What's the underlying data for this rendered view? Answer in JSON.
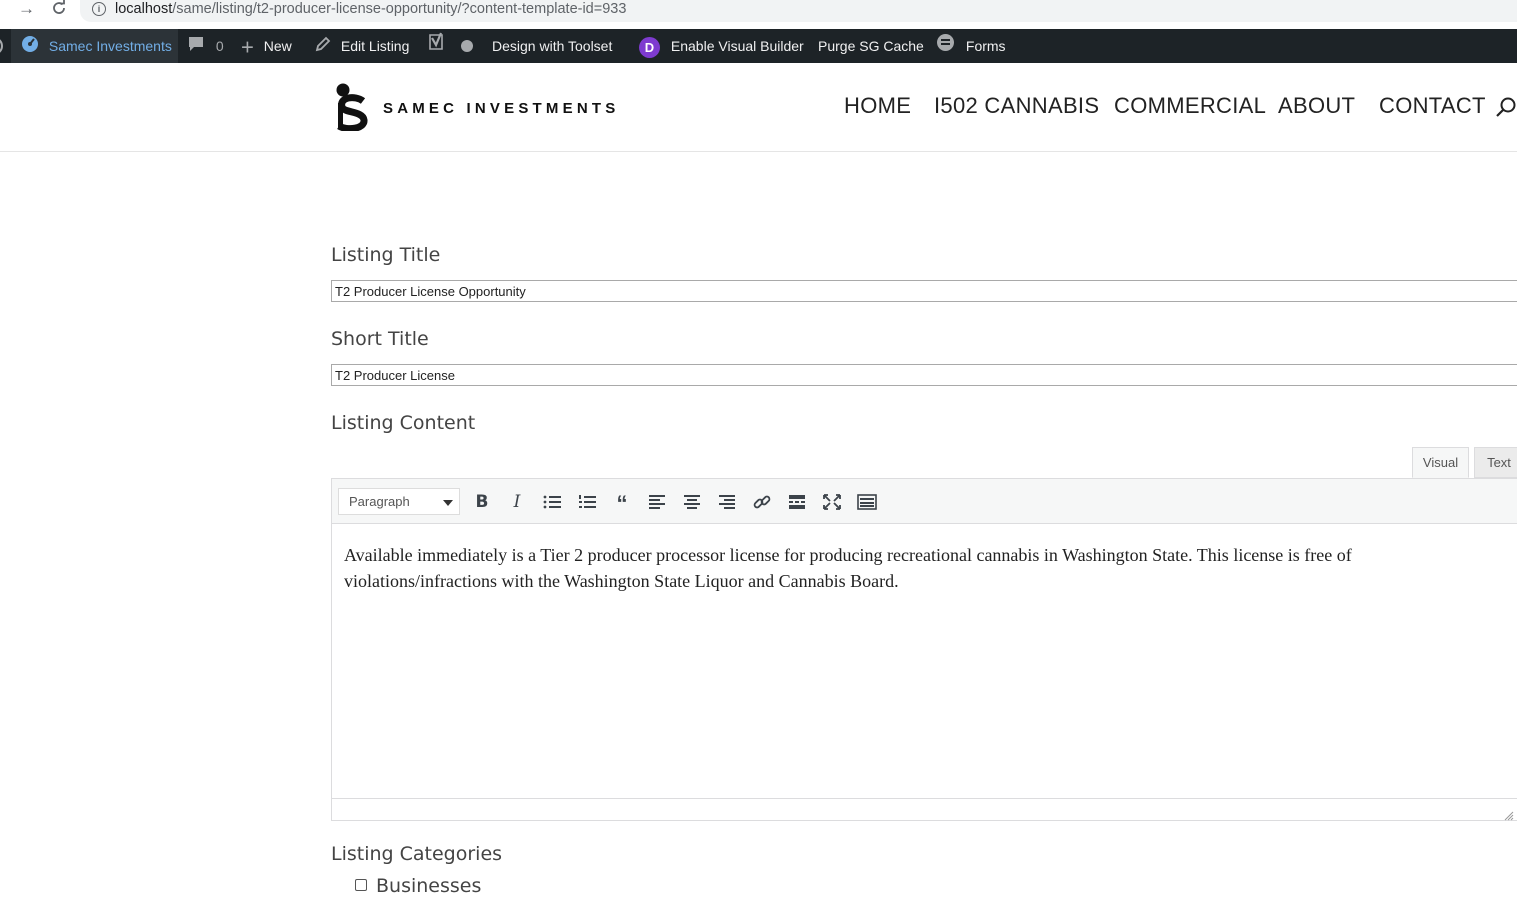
{
  "browser": {
    "url_host": "localhost",
    "url_path": "/same/listing/t2-producer-license-opportunity/?content-template-id=933"
  },
  "adminbar": {
    "site_name": "Samec Investments",
    "comments_count": "0",
    "new_label": "New",
    "edit_listing_label": "Edit Listing",
    "design_toolset_label": "Design with Toolset",
    "visual_builder_label": "Enable Visual Builder",
    "purge_cache_label": "Purge SG Cache",
    "forms_label": "Forms",
    "divi_letter": "D"
  },
  "header": {
    "logo_text": "SAMEC INVESTMENTS",
    "menu": [
      "HOME",
      "I502 CANNABIS",
      "COMMERCIAL",
      "ABOUT",
      "CONTACT"
    ]
  },
  "form": {
    "listing_title_label": "Listing Title",
    "listing_title_value": "T2 Producer License Opportunity",
    "short_title_label": "Short Title",
    "short_title_value": "T2 Producer License",
    "listing_content_label": "Listing Content",
    "tab_visual": "Visual",
    "tab_text": "Text",
    "format_select_value": "Paragraph",
    "content": "Available immediately is a Tier 2 producer processor license for producing recreational cannabis in Washington State. This license is free of violations/infractions with the Washington State Liquor and Cannabis Board.",
    "listing_categories_label": "Listing Categories",
    "category_businesses": "Businesses"
  },
  "colors": {
    "adminbar_bg": "#1d2327",
    "adminbar_site_text": "#72aee6",
    "divi_purple": "#7e3bd0"
  }
}
